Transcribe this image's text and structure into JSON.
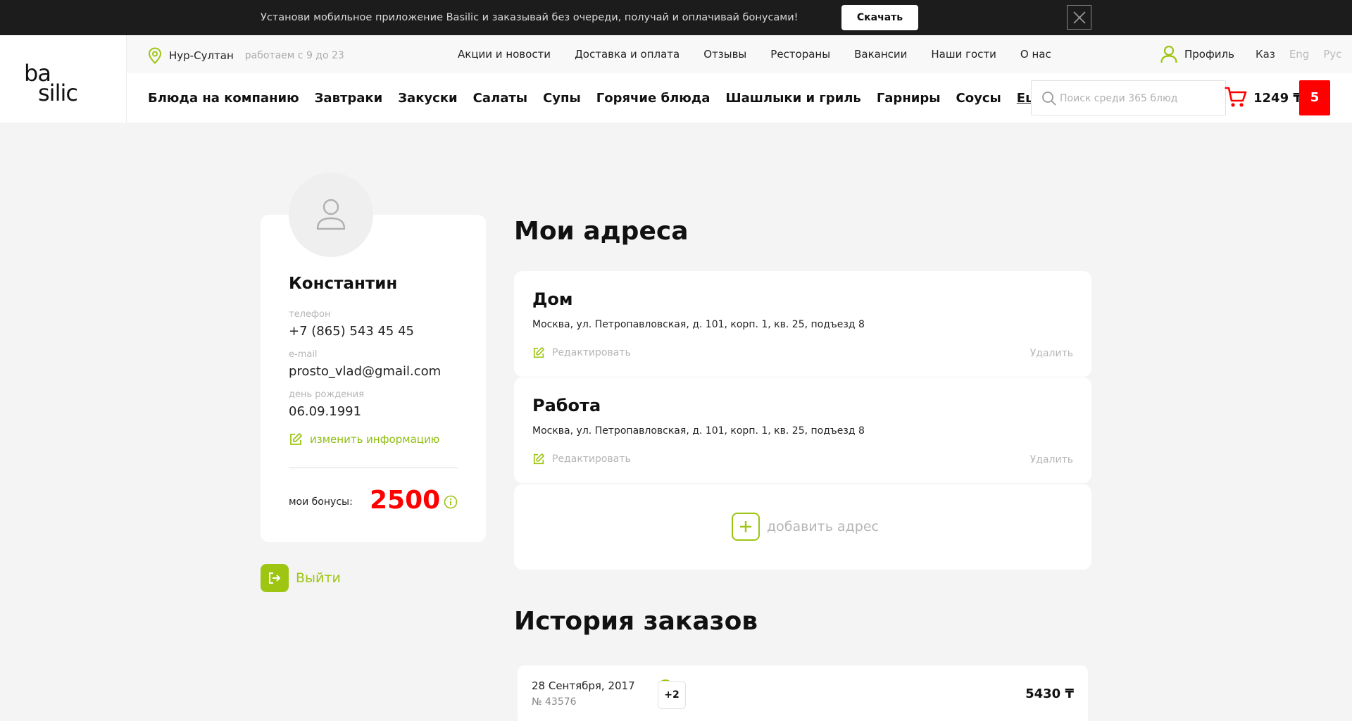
{
  "promo": {
    "text": "Установи мобильное приложение Basilic и заказывай без очереди, получай и оплачивай бонусами!",
    "button": "Скачать",
    "close_icon": "close-icon"
  },
  "logo": {
    "line1": "ba",
    "line2": "silic"
  },
  "topbar": {
    "city": "Нур-Султан",
    "hours": "работаем с 9 до 23",
    "links": [
      "Акции и новости",
      "Доставка и оплата",
      "Отзывы",
      "Рестораны",
      "Вакансии",
      "Наши гости",
      "О нас"
    ],
    "profile": "Профиль",
    "languages": [
      "Каз",
      "Eng",
      "Рус"
    ],
    "active_language": "Каз"
  },
  "mainnav": {
    "items": [
      "Блюда на компанию",
      "Завтраки",
      "Закуски",
      "Салаты",
      "Супы",
      "Горячие блюда",
      "Шашлыки и гриль",
      "Гарниры",
      "Соусы"
    ],
    "more": "Еще"
  },
  "search": {
    "placeholder": "Поиск среди 365 блюд",
    "value": ""
  },
  "cart": {
    "total": "1249 ₸",
    "count": "5"
  },
  "profile_card": {
    "name": "Константин",
    "phone_label": "телефон",
    "phone": "+7 (865) 543 45 45",
    "email_label": "e-mail",
    "email": "prosto_vlad@gmail.com",
    "birthday_label": "день рождения",
    "birthday": "06.09.1991",
    "edit_link": "изменить информацию",
    "bonus_label": "мои бонусы:",
    "bonus_value": "2500",
    "logout": "Выйти"
  },
  "addresses": {
    "heading": "Мои адреса",
    "items": [
      {
        "title": "Дом",
        "address": "Москва, ул. Петропавловская, д. 101, корп. 1, кв. 25, подъезд 8",
        "edit": "Редактировать",
        "delete": "Удалить"
      },
      {
        "title": "Работа",
        "address": "Москва, ул. Петропавловская, д. 101, корп. 1, кв. 25, подъезд 8",
        "edit": "Редактировать",
        "delete": "Удалить"
      }
    ],
    "add": "добавить адрес"
  },
  "history": {
    "heading": "История заказов",
    "orders": [
      {
        "date": "28 Сентября, 2017",
        "number": "№ 43576",
        "more_items": "+2",
        "total": "5430 ₸"
      }
    ]
  },
  "colors": {
    "accent": "#9dc512",
    "accent_text": "#8ebd0e",
    "bonus": "#ff0000",
    "cart_badge": "#ff0000",
    "promo_bg": "#1c1c1c"
  }
}
